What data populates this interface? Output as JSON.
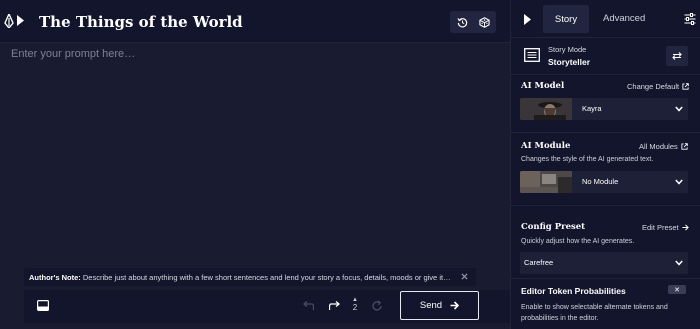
{
  "editor": {
    "title": "The Things of the World",
    "prompt_placeholder": "Enter your prompt here…",
    "authors_note_label": "Author's Note:",
    "authors_note_text": "Describe just about anything with a few short sentences and lend your story a focus, details, moods or give it…",
    "redo_count": "2",
    "send_label": "Send"
  },
  "sidebar": {
    "tabs": [
      {
        "label": "Story",
        "active": true
      },
      {
        "label": "Advanced",
        "active": false
      }
    ],
    "story_mode": {
      "label": "Story Mode",
      "value": "Storyteller"
    },
    "ai_model": {
      "title": "AI Model",
      "link": "Change Default",
      "value": "Kayra"
    },
    "ai_module": {
      "title": "AI Module",
      "link": "All Modules",
      "description": "Changes the style of the AI generated text.",
      "value": "No Module"
    },
    "config_preset": {
      "title": "Config Preset",
      "link": "Edit Preset",
      "description": "Quickly adjust how the AI generates.",
      "value": "Carefree"
    },
    "editor_token_probabilities": {
      "title": "Editor Token Probabilities",
      "toggle_label": "✕",
      "description_line1": "Enable to show selectable alternate tokens and",
      "description_line2": "probabilities in the editor."
    }
  },
  "colors": {
    "background": "#191b31",
    "panel": "#13152c",
    "control": "#22253f",
    "muted_text": "#7f8095"
  }
}
